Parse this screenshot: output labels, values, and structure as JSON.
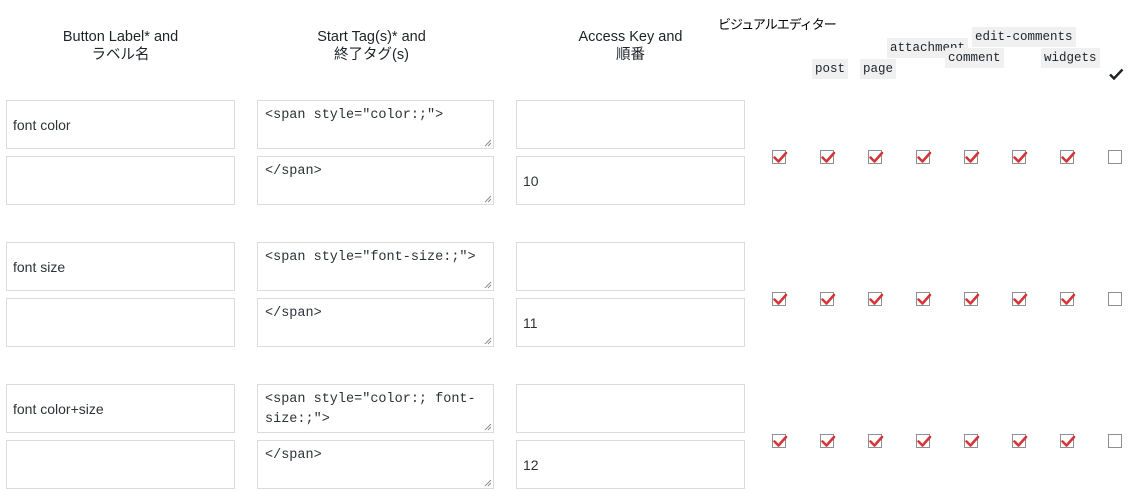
{
  "headers": {
    "label_line1": "Button Label* and",
    "label_line2": "ラベル名",
    "tags_line1": "Start Tag(s)* and",
    "tags_line2": "終了タグ(s)",
    "key_line1": "Access Key and",
    "key_line2": "順番",
    "visual_editor": "ビジュアルエディター"
  },
  "columns": [
    "post",
    "page",
    "attachment",
    "comment",
    "edit-comments",
    "widgets"
  ],
  "rows": [
    {
      "label": "font color",
      "label2": "",
      "start_tag": "<span style=\"color:;\">",
      "end_tag": "</span>",
      "access_key": "",
      "order": "10",
      "checks": [
        true,
        true,
        true,
        true,
        true,
        true,
        true,
        false
      ]
    },
    {
      "label": "font size",
      "label2": "",
      "start_tag": "<span style=\"font-size:;\">",
      "end_tag": "</span>",
      "access_key": "",
      "order": "11",
      "checks": [
        true,
        true,
        true,
        true,
        true,
        true,
        true,
        false
      ]
    },
    {
      "label": "font color+size",
      "label2": "",
      "start_tag": "<span style=\"color:; font-\nsize:;\">",
      "end_tag": "</span>",
      "access_key": "",
      "order": "12",
      "checks": [
        true,
        true,
        true,
        true,
        true,
        true,
        true,
        false
      ]
    }
  ],
  "colors": {
    "check": "#d63638",
    "border": "#dcdcde"
  }
}
